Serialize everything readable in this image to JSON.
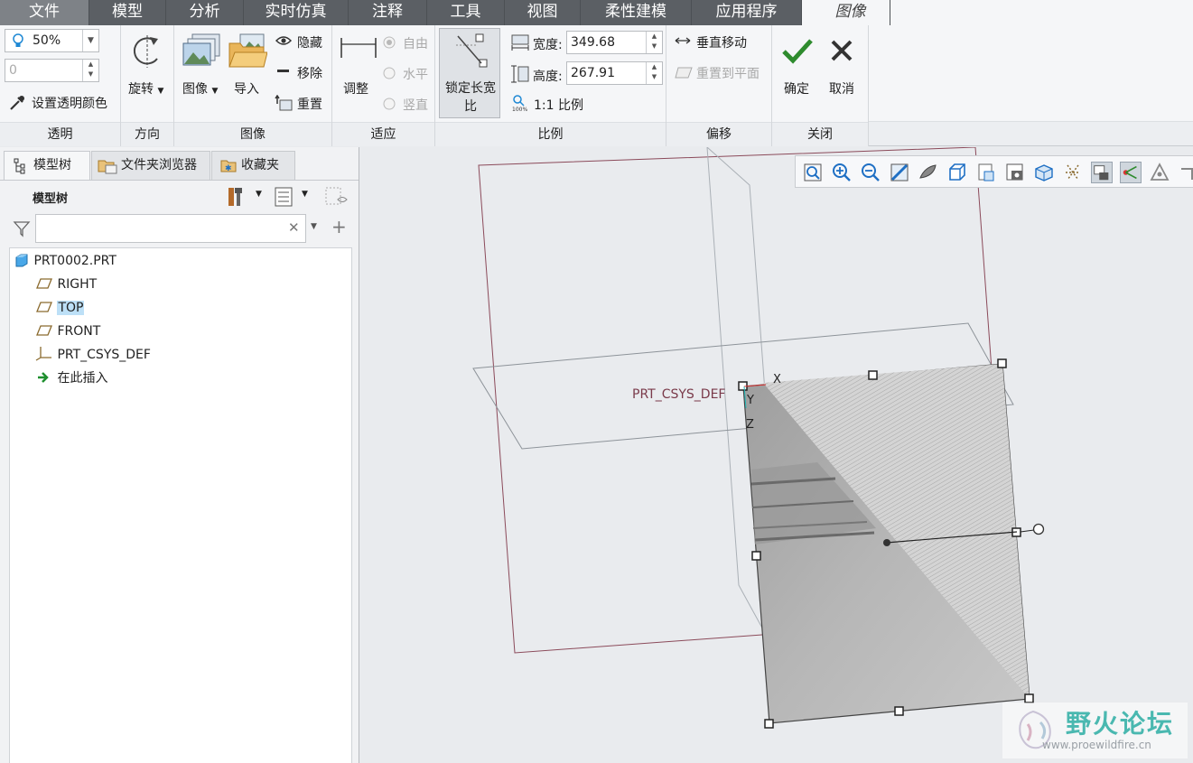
{
  "menu": {
    "tabs": [
      "文件",
      "模型",
      "分析",
      "实时仿真",
      "注释",
      "工具",
      "视图",
      "柔性建模",
      "应用程序",
      "图像"
    ]
  },
  "ribbon": {
    "transparency": {
      "value": "50%",
      "field2": "0",
      "set_color": "设置透明颜色",
      "label": "透明"
    },
    "orientation": {
      "rotate": "旋转",
      "label": "方向"
    },
    "image": {
      "image_btn": "图像",
      "import_btn": "导入",
      "hide": "隐藏",
      "remove": "移除",
      "reset": "重置",
      "label": "图像"
    },
    "fit": {
      "adjust": "调整",
      "free": "自由",
      "horizontal": "水平",
      "vertical": "竖直",
      "label": "适应"
    },
    "scale": {
      "lock_ratio": "锁定长宽比",
      "width_label": "宽度:",
      "width_value": "349.68",
      "height_label": "高度:",
      "height_value": "267.91",
      "one_to_one": "1:1 比例",
      "label": "比例"
    },
    "offset": {
      "vertical_move": "垂直移动",
      "reset_plane": "重置到平面",
      "label": "偏移"
    },
    "close": {
      "ok": "确定",
      "cancel": "取消",
      "label": "关闭"
    }
  },
  "left_panel": {
    "tabs": [
      "模型树",
      "文件夹浏览器",
      "收藏夹"
    ],
    "title": "模型树",
    "tree": [
      {
        "label": "PRT0002.PRT",
        "icon": "part-icon"
      },
      {
        "label": "RIGHT",
        "icon": "datum-plane-icon"
      },
      {
        "label": "TOP",
        "icon": "datum-plane-icon",
        "selected": true
      },
      {
        "label": "FRONT",
        "icon": "datum-plane-icon"
      },
      {
        "label": "PRT_CSYS_DEF",
        "icon": "csys-icon"
      },
      {
        "label": "在此插入",
        "icon": "insert-arrow-icon"
      }
    ]
  },
  "viewport": {
    "csys_label": "PRT_CSYS_DEF",
    "axis_x": "X",
    "axis_y": "Y",
    "axis_z": "Z"
  },
  "watermark": {
    "title": "野火论坛",
    "url": "www.proewildfire.cn"
  },
  "colors": {
    "menu_bg": "#5b5f64",
    "ribbon_bg": "#f5f6f8",
    "viewport_bg": "#e9ebee",
    "selection": "#bde0f7",
    "datum_plane": "#8b4a5a"
  }
}
